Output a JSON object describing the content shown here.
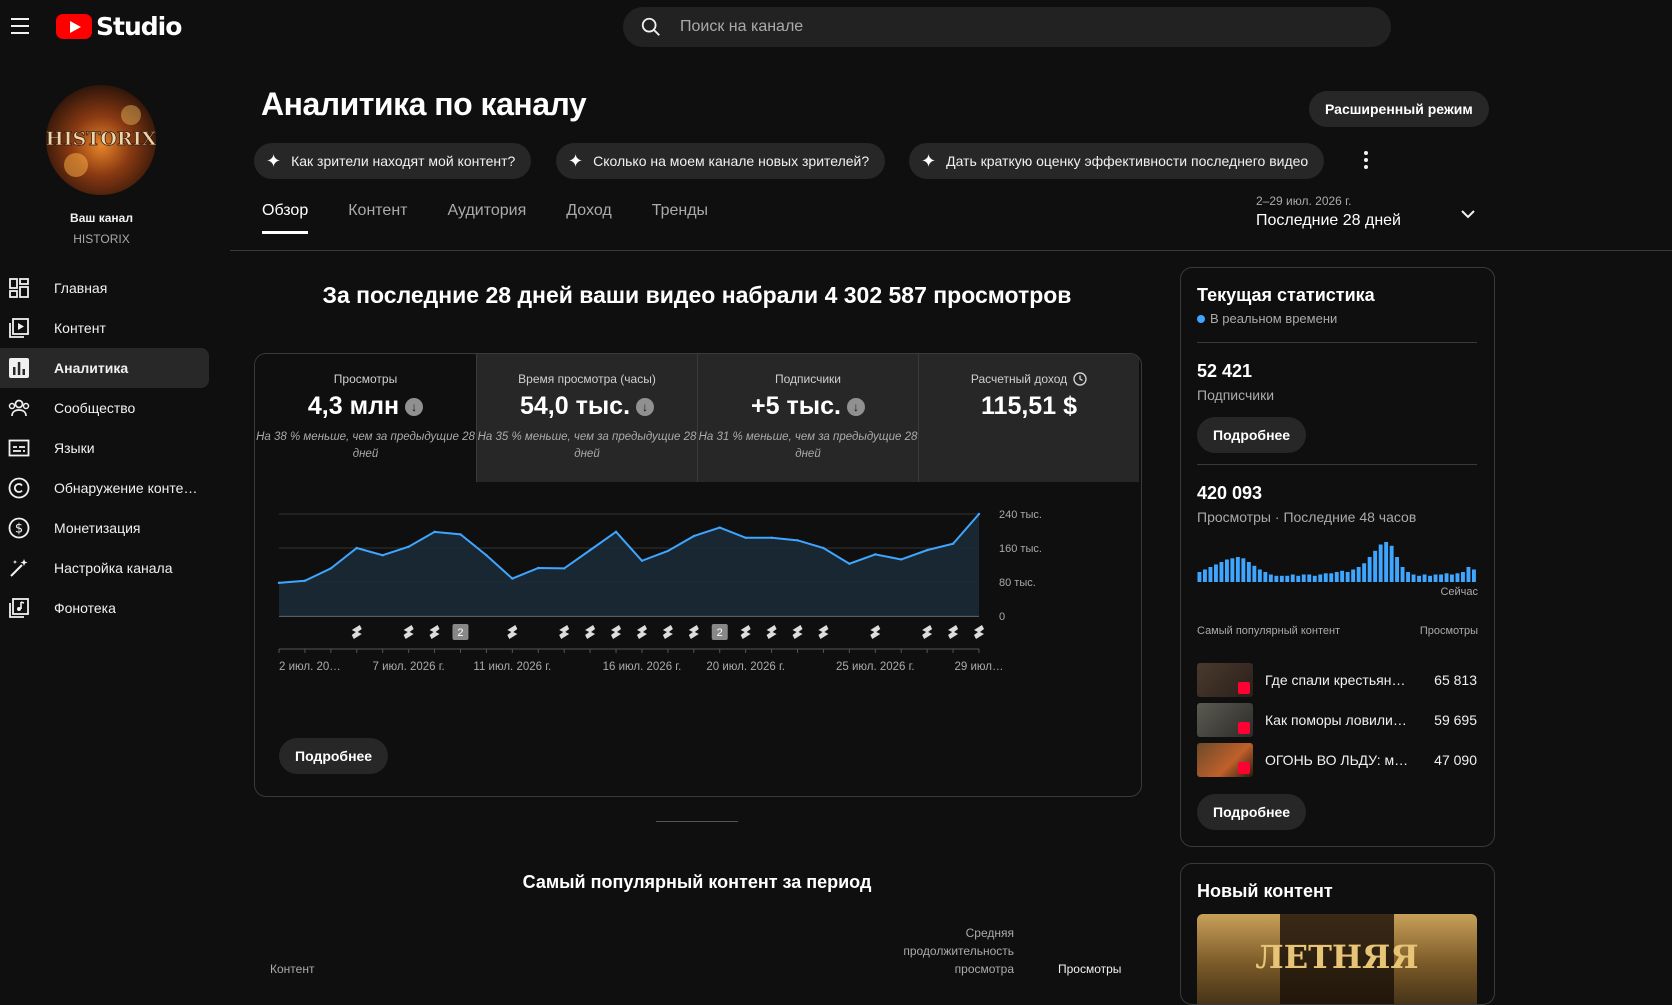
{
  "header": {
    "logo_text": "Studio",
    "search_placeholder": "Поиск на канале"
  },
  "sidebar": {
    "your_channel": "Ваш канал",
    "channel_name": "HISTORIX",
    "avatar_text": "HISTORIX",
    "items": [
      {
        "label": "Главная",
        "icon": "dashboard-icon"
      },
      {
        "label": "Контент",
        "icon": "content-icon"
      },
      {
        "label": "Аналитика",
        "icon": "analytics-icon",
        "active": true
      },
      {
        "label": "Сообщество",
        "icon": "community-icon"
      },
      {
        "label": "Языки",
        "icon": "subtitles-icon"
      },
      {
        "label": "Обнаружение контен…",
        "icon": "copyright-icon"
      },
      {
        "label": "Монетизация",
        "icon": "monetization-icon"
      },
      {
        "label": "Настройка канала",
        "icon": "customization-icon"
      },
      {
        "label": "Фонотека",
        "icon": "audio-library-icon"
      }
    ]
  },
  "page": {
    "title": "Аналитика по каналу",
    "advanced_mode": "Расширенный режим",
    "chips": [
      "Как зрители находят мой контент?",
      "Сколько на моем канале новых зрителей?",
      "Дать краткую оценку эффективности последнего видео"
    ],
    "tabs": [
      "Обзор",
      "Контент",
      "Аудитория",
      "Доход",
      "Тренды"
    ],
    "date_sub": "2–29 июл. 2026 г.",
    "date_main": "Последние 28 дней"
  },
  "overview": {
    "headline": "За последние 28 дней ваши видео набрали 4 302 587 просмотров",
    "metrics": [
      {
        "title": "Просмотры",
        "value": "4,3 млн",
        "compare": "На 38 % меньше, чем за предыдущие 28 дней"
      },
      {
        "title": "Время просмотра (часы)",
        "value": "54,0 тыс.",
        "compare": "На 35 % меньше, чем за предыдущие 28 дней"
      },
      {
        "title": "Подписчики",
        "value": "+5 тыс.",
        "compare": "На 31 % меньше, чем за предыдущие 28 дней"
      },
      {
        "title": "Расчетный доход",
        "value": "115,51 $",
        "compare": ""
      }
    ],
    "more_button": "Подробнее",
    "popular_title": "Самый популярный контент за период",
    "table_headers": {
      "content": "Контент",
      "avg_duration": "Средняя продолжительность просмотра",
      "views": "Просмотры"
    }
  },
  "chart_data": {
    "type": "area",
    "x": [
      "2 июл.",
      "3 июл.",
      "4 июл.",
      "5 июл.",
      "6 июл.",
      "7 июл.",
      "8 июл.",
      "9 июл.",
      "10 июл.",
      "11 июл.",
      "12 июл.",
      "13 июл.",
      "14 июл.",
      "15 июл.",
      "16 июл.",
      "17 июл.",
      "18 июл.",
      "19 июл.",
      "20 июл.",
      "21 июл.",
      "22 июл.",
      "23 июл.",
      "24 июл.",
      "25 июл.",
      "26 июл.",
      "27 июл.",
      "28 июл.",
      "29 июл."
    ],
    "values": [
      78,
      83,
      112,
      160,
      143,
      163,
      198,
      192,
      143,
      88,
      113,
      112,
      155,
      198,
      130,
      153,
      188,
      208,
      184,
      184,
      178,
      160,
      123,
      145,
      133,
      155,
      170,
      240
    ],
    "y_ticks": [
      "0",
      "80 тыс.",
      "160 тыс.",
      "240 тыс."
    ],
    "ylim": [
      0,
      240
    ],
    "x_tick_labels": [
      {
        "i": 0,
        "label": "2 июл. 20…"
      },
      {
        "i": 5,
        "label": "7 июл. 2026 г."
      },
      {
        "i": 9,
        "label": "11 июл. 2026 г."
      },
      {
        "i": 14,
        "label": "16 июл. 2026 г."
      },
      {
        "i": 18,
        "label": "20 июл. 2026 г."
      },
      {
        "i": 23,
        "label": "25 июл. 2026 г."
      },
      {
        "i": 27,
        "label": "29 июл…"
      }
    ],
    "markers": [
      {
        "i": 3,
        "type": "shorts"
      },
      {
        "i": 5,
        "type": "shorts"
      },
      {
        "i": 6,
        "type": "shorts"
      },
      {
        "i": 7,
        "type": "count",
        "label": "2"
      },
      {
        "i": 9,
        "type": "shorts"
      },
      {
        "i": 11,
        "type": "shorts"
      },
      {
        "i": 12,
        "type": "shorts"
      },
      {
        "i": 13,
        "type": "shorts"
      },
      {
        "i": 14,
        "type": "shorts"
      },
      {
        "i": 15,
        "type": "shorts"
      },
      {
        "i": 16,
        "type": "shorts"
      },
      {
        "i": 17,
        "type": "count",
        "label": "2"
      },
      {
        "i": 18,
        "type": "shorts"
      },
      {
        "i": 19,
        "type": "shorts"
      },
      {
        "i": 20,
        "type": "shorts"
      },
      {
        "i": 21,
        "type": "shorts"
      },
      {
        "i": 23,
        "type": "shorts"
      },
      {
        "i": 25,
        "type": "shorts"
      },
      {
        "i": 26,
        "type": "shorts"
      },
      {
        "i": 27,
        "type": "shorts"
      }
    ],
    "colors": {
      "line": "#3ea6ff",
      "fill": "#1a2a36"
    }
  },
  "realtime": {
    "title": "Текущая статистика",
    "live": "В реальном времени",
    "subscribers_value": "52 421",
    "subscribers_label": "Подписчики",
    "more_button": "Подробнее",
    "views_value": "420 093",
    "views_label": "Просмотры · Последние 48 часов",
    "now_label": "Сейчас",
    "bars": [
      8,
      10,
      12,
      14,
      16,
      18,
      19,
      20,
      19,
      16,
      13,
      10,
      8,
      6,
      5,
      5,
      5,
      6,
      5,
      6,
      6,
      5,
      6,
      7,
      7,
      8,
      9,
      8,
      10,
      12,
      15,
      20,
      25,
      30,
      32,
      29,
      20,
      12,
      8,
      6,
      5,
      6,
      5,
      6,
      6,
      7,
      6,
      7,
      8,
      12,
      10
    ],
    "top_content_label": "Самый популярный контент",
    "top_views_label": "Просмотры",
    "top_videos": [
      {
        "title": "Где спали крестьяне…",
        "views": "65 813"
      },
      {
        "title": "Как поморы ловили…",
        "views": "59 695"
      },
      {
        "title": "ОГОНЬ ВО ЛЬДУ: ма…",
        "views": "47 090"
      }
    ],
    "more_button2": "Подробнее"
  },
  "new_content": {
    "title": "Новый контент",
    "thumb_text": "ЛЕТНЯЯ"
  }
}
